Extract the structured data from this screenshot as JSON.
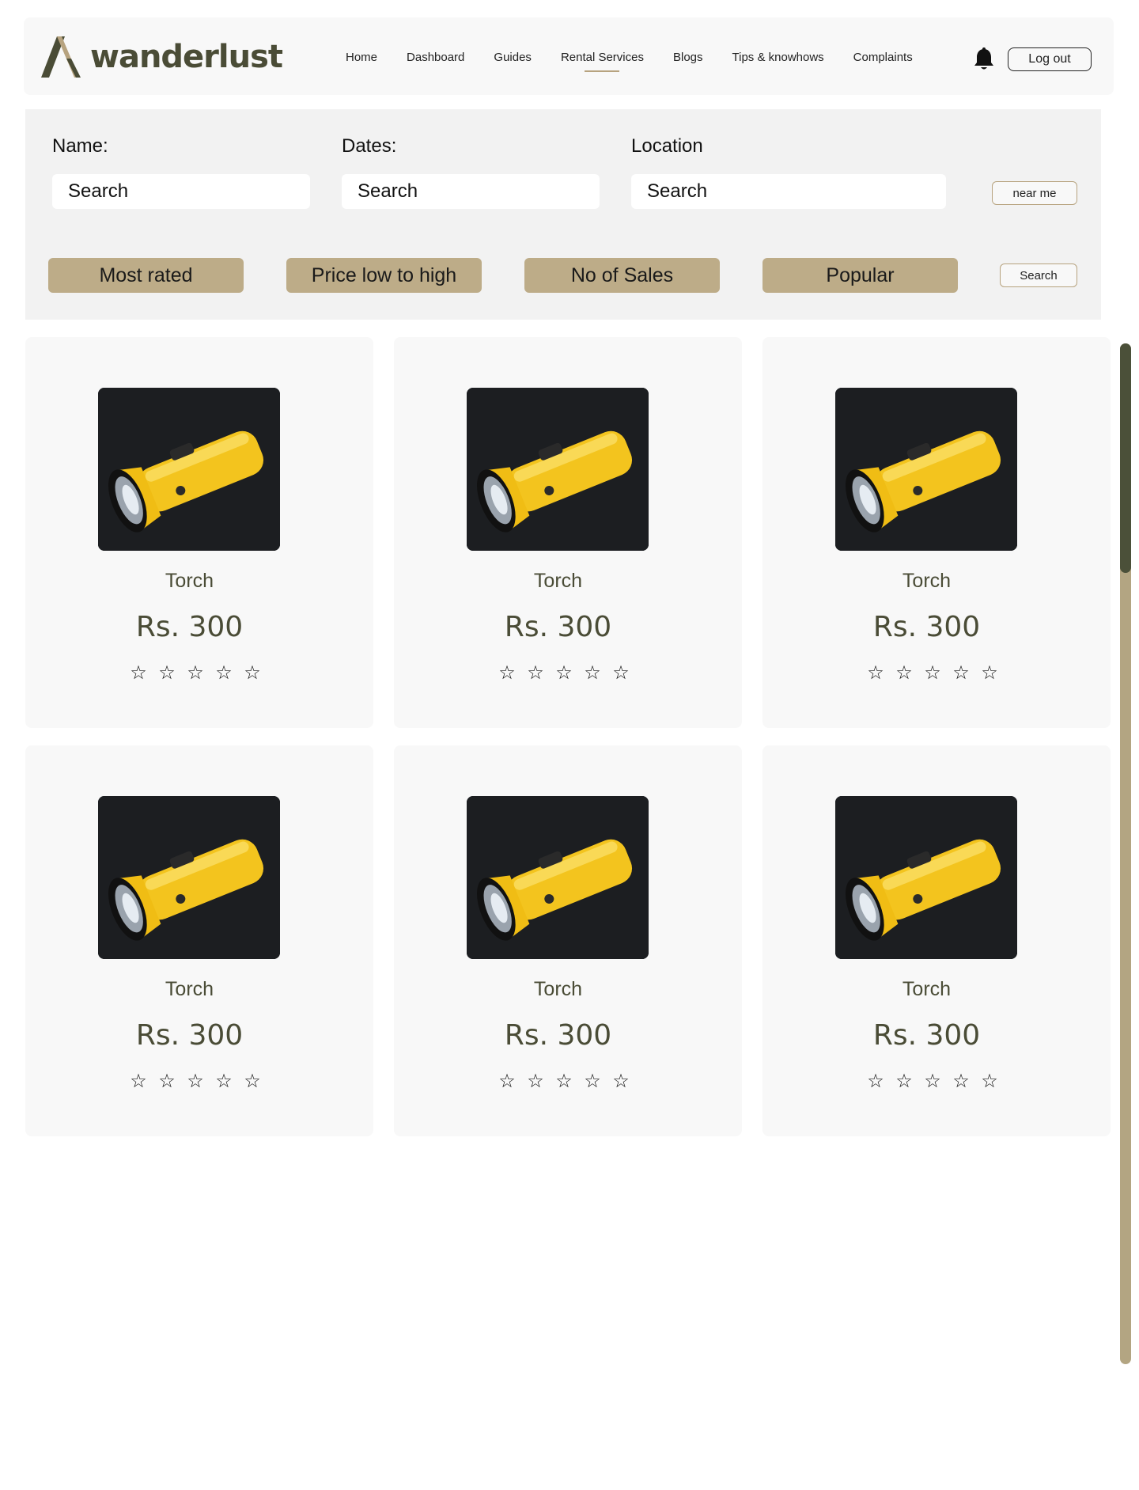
{
  "brand": {
    "name": "wanderlust",
    "logo_icon": "wanderlust-logo-mark"
  },
  "nav": {
    "items": [
      {
        "label": "Home",
        "name": "nav-home",
        "active": false
      },
      {
        "label": "Dashboard",
        "name": "nav-dashboard",
        "active": false
      },
      {
        "label": "Guides",
        "name": "nav-guides",
        "active": false
      },
      {
        "label": "Rental Services",
        "name": "nav-rental-services",
        "active": true
      },
      {
        "label": "Blogs",
        "name": "nav-blogs",
        "active": false
      },
      {
        "label": "Tips & knowhows",
        "name": "nav-tips",
        "active": false
      },
      {
        "label": "Complaints",
        "name": "nav-complaints",
        "active": false
      }
    ],
    "notification_icon": "bell-icon",
    "logout_label": "Log out"
  },
  "filters": {
    "name_label": "Name:",
    "name_placeholder": "Search",
    "dates_label": "Dates:",
    "dates_placeholder": "Search",
    "location_label": "Location",
    "location_placeholder": "Search",
    "near_me_label": "near me",
    "sort_options": [
      "Most rated",
      "Price low to high",
      "No of Sales",
      "Popular"
    ],
    "search_label": "Search"
  },
  "products": [
    {
      "name": "Torch",
      "price": "Rs. 300",
      "stars": [
        "☆",
        "☆",
        "☆",
        "☆",
        "☆"
      ],
      "image": "yellow-flashlight"
    },
    {
      "name": "Torch",
      "price": "Rs. 300",
      "stars": [
        "☆",
        "☆",
        "☆",
        "☆",
        "☆"
      ],
      "image": "yellow-flashlight"
    },
    {
      "name": "Torch",
      "price": "Rs. 300",
      "stars": [
        "☆",
        "☆",
        "☆",
        "☆",
        "☆"
      ],
      "image": "yellow-flashlight"
    },
    {
      "name": "Torch",
      "price": "Rs. 300",
      "stars": [
        "☆",
        "☆",
        "☆",
        "☆",
        "☆"
      ],
      "image": "yellow-flashlight"
    },
    {
      "name": "Torch",
      "price": "Rs. 300",
      "stars": [
        "☆",
        "☆",
        "☆",
        "☆",
        "☆"
      ],
      "image": "yellow-flashlight"
    },
    {
      "name": "Torch",
      "price": "Rs. 300",
      "stars": [
        "☆",
        "☆",
        "☆",
        "☆",
        "☆"
      ],
      "image": "yellow-flashlight"
    }
  ],
  "colors": {
    "accent": "#bdac88",
    "brand_dark": "#4a4c36",
    "panel": "#f2f2f2",
    "card": "#f8f8f8",
    "scroll_track": "#b3a582",
    "scroll_thumb": "#4b5039"
  }
}
